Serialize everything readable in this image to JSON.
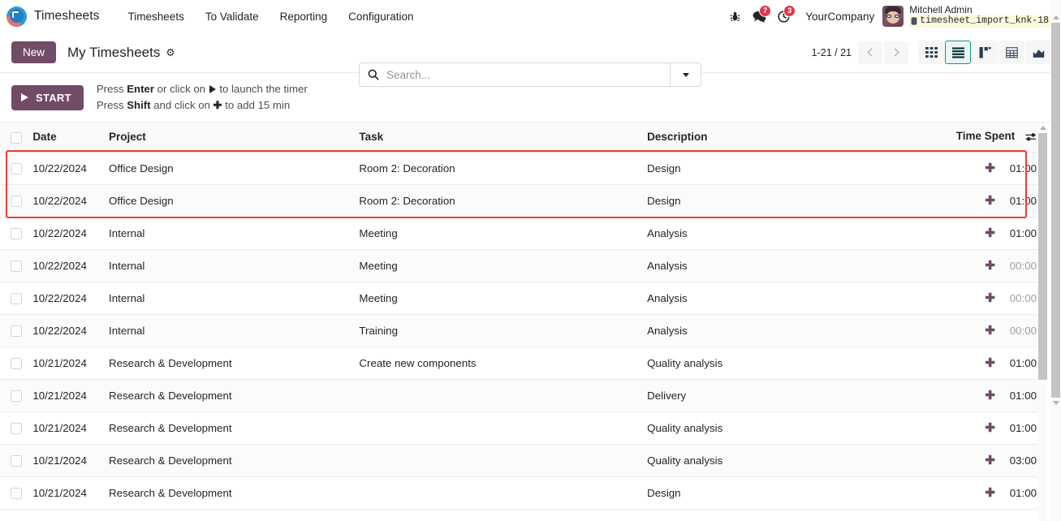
{
  "navbar": {
    "brand": "Timesheets",
    "logo_icon": "odoo-timer-logo",
    "menu": [
      {
        "label": "Timesheets"
      },
      {
        "label": "To Validate"
      },
      {
        "label": "Reporting"
      },
      {
        "label": "Configuration"
      }
    ],
    "sys_icons": [
      {
        "name": "bug-icon",
        "glyph": "🐞",
        "badge": ""
      },
      {
        "name": "messages-icon",
        "glyph": "💬",
        "badge": "7"
      },
      {
        "name": "activities-clock-icon",
        "glyph": "🕘",
        "badge": "3"
      }
    ],
    "company": "YourCompany",
    "user_name": "Mitchell Admin",
    "database": "timesheet_import_knk-18",
    "database_icon": "database-icon"
  },
  "control_panel": {
    "new_label": "New",
    "title": "My Timesheets",
    "gear_icon": "gear-icon",
    "search_placeholder": "Search...",
    "search_value": "",
    "search_icon": "search-icon",
    "dropdown_icon": "chevron-down-icon",
    "pager_count": "1-21 / 21",
    "prev_icon": "chevron-left-icon",
    "next_icon": "chevron-right-icon",
    "views": [
      {
        "name": "kanban-view",
        "active": false
      },
      {
        "name": "list-view",
        "active": true
      },
      {
        "name": "gantt-view",
        "active": false
      },
      {
        "name": "pivot-view",
        "active": false
      },
      {
        "name": "graph-view",
        "active": false
      }
    ]
  },
  "timer": {
    "start_label": "START",
    "play_icon": "play-icon",
    "hint_line1_prefix": "Press ",
    "hint_line1_key": "Enter",
    "hint_line1_mid": " or click on ",
    "hint_line1_suffix": " to launch the timer",
    "hint_line2_prefix": "Press ",
    "hint_line2_key": "Shift",
    "hint_line2_mid": " and click on ",
    "hint_line2_plus": "➕",
    "hint_line2_suffix": " to add 15 min"
  },
  "table": {
    "columns": [
      "Date",
      "Project",
      "Task",
      "Description",
      "Time Spent"
    ],
    "optional_columns_icon": "column-settings-icon",
    "select_all_checkbox": "select-all-checkbox",
    "rows": [
      {
        "date": "10/22/2024",
        "project": "Office Design",
        "task": "Room 2: Decoration",
        "description": "Design",
        "time": "01:00",
        "highlighted": true
      },
      {
        "date": "10/22/2024",
        "project": "Office Design",
        "task": "Room 2: Decoration",
        "description": "Design",
        "time": "01:00",
        "highlighted": true
      },
      {
        "date": "10/22/2024",
        "project": "Internal",
        "task": "Meeting",
        "description": "Analysis",
        "time": "01:00",
        "highlighted": false
      },
      {
        "date": "10/22/2024",
        "project": "Internal",
        "task": "Meeting",
        "description": "Analysis",
        "time": "00:00",
        "highlighted": false
      },
      {
        "date": "10/22/2024",
        "project": "Internal",
        "task": "Meeting",
        "description": "Analysis",
        "time": "00:00",
        "highlighted": false
      },
      {
        "date": "10/22/2024",
        "project": "Internal",
        "task": "Training",
        "description": "Analysis",
        "time": "00:00",
        "highlighted": false
      },
      {
        "date": "10/21/2024",
        "project": "Research & Development",
        "task": "Create new components",
        "description": "Quality analysis",
        "time": "01:00",
        "highlighted": false
      },
      {
        "date": "10/21/2024",
        "project": "Research & Development",
        "task": "",
        "description": "Delivery",
        "time": "01:00",
        "highlighted": false
      },
      {
        "date": "10/21/2024",
        "project": "Research & Development",
        "task": "",
        "description": "Quality analysis",
        "time": "01:00",
        "highlighted": false
      },
      {
        "date": "10/21/2024",
        "project": "Research & Development",
        "task": "",
        "description": "Quality analysis",
        "time": "03:00",
        "highlighted": false
      },
      {
        "date": "10/21/2024",
        "project": "Research & Development",
        "task": "",
        "description": "Design",
        "time": "01:00",
        "highlighted": false
      }
    ]
  },
  "colors": {
    "brand_purple": "#714b67",
    "badge_red": "#e8344a",
    "annotation_red": "#f33b2f",
    "active_view_teal": "#0d9488",
    "db_highlight": "#fdf8dc"
  }
}
